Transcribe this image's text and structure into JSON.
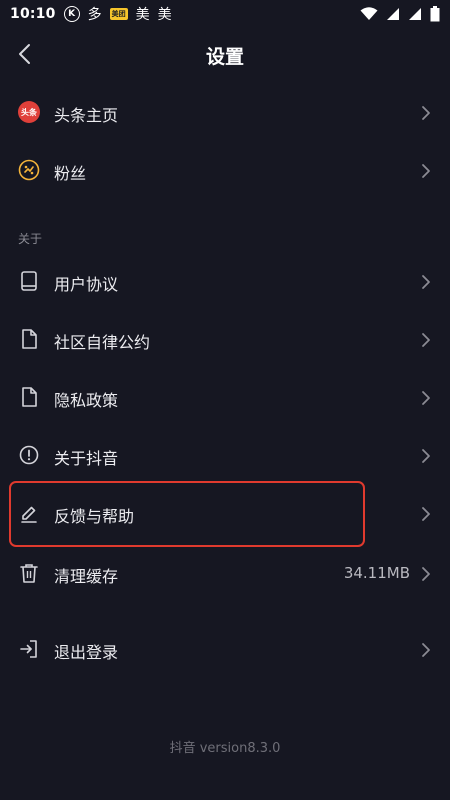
{
  "status_bar": {
    "time": "10:10",
    "k_badge": "K",
    "tieba_glyph": "多",
    "meituan_badge": "美团",
    "meituan_1": "美",
    "meituan_2": "美",
    "icons": [
      "wifi-icon",
      "signal-icon",
      "signal-icon",
      "battery-icon"
    ]
  },
  "header": {
    "title": "设置"
  },
  "items": {
    "toutiao": {
      "label": "头条主页",
      "icon_text": "头条"
    },
    "fans": {
      "label": "粉丝"
    },
    "user_agreement": {
      "label": "用户协议"
    },
    "community": {
      "label": "社区自律公约"
    },
    "privacy": {
      "label": "隐私政策"
    },
    "about": {
      "label": "关于抖音"
    },
    "feedback": {
      "label": "反馈与帮助"
    },
    "cache": {
      "label": "清理缓存",
      "value": "34.11MB"
    },
    "logout": {
      "label": "退出登录"
    }
  },
  "section_about": "关于",
  "footer": {
    "version": "抖音 version8.3.0"
  },
  "colors": {
    "background": "#161722",
    "highlight": "#e03a2e",
    "toutiao_red": "#e0403a",
    "fans_orange": "#f5b43a"
  }
}
